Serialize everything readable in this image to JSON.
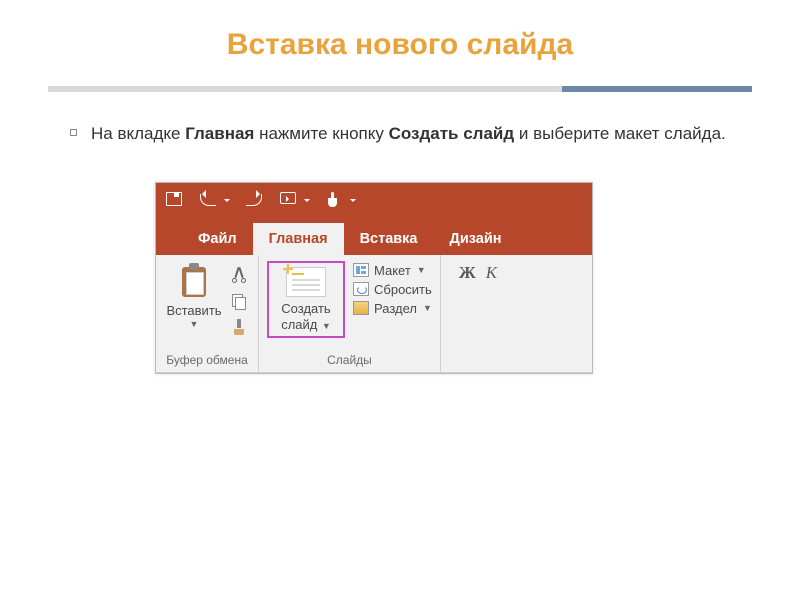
{
  "title": "Вставка нового слайда",
  "bullet": {
    "pre": "На вкладке ",
    "b1": "Главная",
    "mid": " нажмите кнопку ",
    "b2": "Создать слайд",
    "post": " и выберите макет слайда."
  },
  "tabs": {
    "file": "Файл",
    "home": "Главная",
    "insert": "Вставка",
    "design": "Дизайн"
  },
  "clipboard": {
    "paste": "Вставить",
    "group": "Буфер обмена"
  },
  "slides": {
    "new_l1": "Создать",
    "new_l2": "слайд",
    "layout": "Макет",
    "reset": "Сбросить",
    "section": "Раздел",
    "group": "Слайды"
  },
  "font": {
    "bold": "Ж",
    "italic": "К"
  },
  "glyphs": {
    "dd": "▼"
  }
}
